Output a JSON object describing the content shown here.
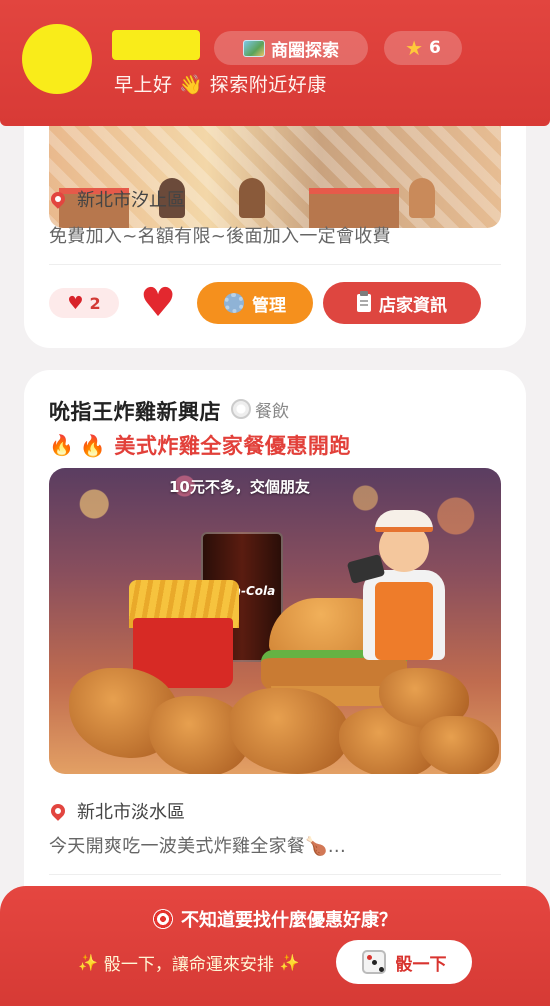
{
  "header": {
    "greeting": "早上好 👋 探索附近好康",
    "explore_label": "商圈探索",
    "stars_count": "6"
  },
  "card1": {
    "location": "新北市汐止區",
    "description": "免費加入~名額有限~後面加入一定會收費",
    "like_count": "2",
    "manage_label": "管理",
    "store_info_label": "店家資訊"
  },
  "card2": {
    "store_name": "吮指王炸雞新興店",
    "category": "餐飲",
    "promo": "🔥 美式炸雞全家餐優惠開跑",
    "image_caption": "10元不多，交個朋友",
    "cola_brand": "Coca-Cola",
    "location": "新北市淡水區",
    "description": "今天開爽吃一波美式炸雞全家餐🍗..."
  },
  "bottom_banner": {
    "title": "不知道要找什麼優惠好康？",
    "subtitle": "骰一下，讓命運來安排",
    "dice_label": "骰一下"
  },
  "colors": {
    "brand_red": "#e2453f",
    "orange": "#f5901d",
    "redact_yellow": "#f9ec1a"
  }
}
